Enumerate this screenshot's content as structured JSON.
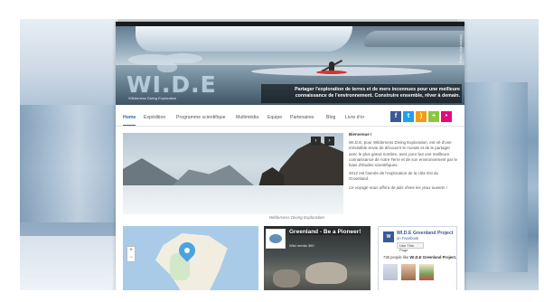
{
  "banner": {
    "logo": "WI.D.E",
    "logo_sub": "Wilderness Diving Exploration",
    "tagline_line1": "Partager l'exploration de terres et de mers inconnues pour une meilleure",
    "tagline_line2": "connaissance de l'environnement. Construire ensemble, rêver à demain.",
    "side_credit": "Wilderness Diving"
  },
  "nav": {
    "items": [
      "Home",
      "Expédition",
      "Programme scientifique",
      "Multimédia",
      "Equipe",
      "Partenaires",
      "Blog",
      "Livre d'or"
    ],
    "active": "Home"
  },
  "social": [
    {
      "name": "facebook-icon",
      "glyph": "f",
      "color": "#3b5998"
    },
    {
      "name": "twitter-icon",
      "glyph": "t",
      "color": "#1da1f2"
    },
    {
      "name": "rss-icon",
      "glyph": ")",
      "color": "#f39c12"
    },
    {
      "name": "share-icon",
      "glyph": "+",
      "color": "#8cc63f"
    },
    {
      "name": "flickr-icon",
      "glyph": "•",
      "color": "#e5097f"
    }
  ],
  "slider": {
    "prev": "‹",
    "next": "›",
    "caption": "Wilderness Diving Exploration"
  },
  "intro": {
    "heading": "Bienvenue !",
    "para1": "WI.D.E, pour Wilderness Diving Exploration, est né d'une irrésistible envie de découvrir le monde et de le partager avec le plus grand nombre, avec pour but une meilleure connaissance de notre Terre et de son environnement par le biais d'études scientifiques.",
    "para2": "2012 est l'année de l'exploration de la côte Est du Groenland.",
    "para3": "Ce voyage nous offrira de jolis rêves les yeux ouverts !"
  },
  "video": {
    "title": "Greenland - Be a Pioneer!",
    "subtitle": "Wild media 360"
  },
  "facebook": {
    "title": "WI.D.E Greenland Project",
    "subtitle": "on Facebook",
    "like_label": "Like This Page",
    "count_prefix": "736 people like",
    "count_name": "WI.D.E Greenland Project."
  }
}
